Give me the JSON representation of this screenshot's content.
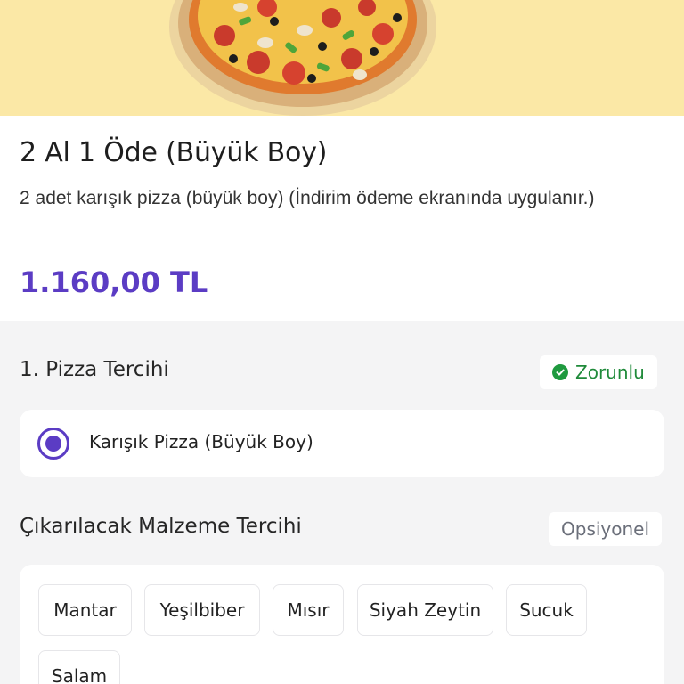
{
  "product": {
    "title": "2 Al 1 Öde (Büyük Boy)",
    "description": "2 adet karışık pizza (büyük boy) (İndirim ödeme ekranında uygulanır.)",
    "price": "1.160,00 TL"
  },
  "pizza_section": {
    "title": "1. Pizza Tercihi",
    "badge": "Zorunlu",
    "options": [
      {
        "label": "Karışık Pizza (Büyük Boy)",
        "selected": true
      }
    ]
  },
  "remove_section": {
    "title": "Çıkarılacak Malzeme Tercihi",
    "badge": "Opsiyonel",
    "chips": [
      "Mantar",
      "Yeşilbiber",
      "Mısır",
      "Siyah Zeytin",
      "Sucuk",
      "Salam"
    ]
  },
  "colors": {
    "accent": "#5b3cc4",
    "hero_bg": "#fbe8a6",
    "required_green": "#1f8a3a"
  }
}
